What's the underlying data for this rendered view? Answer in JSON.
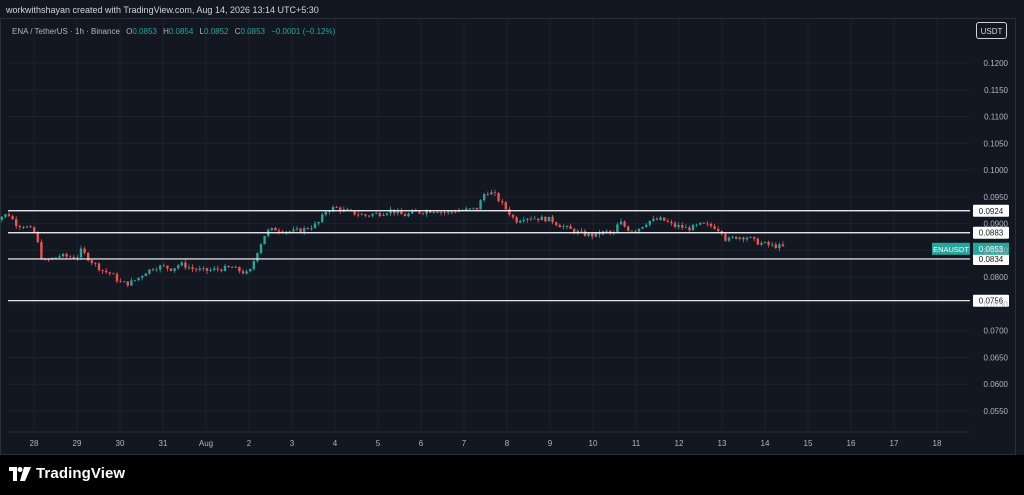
{
  "credit": "workwithshayan created with TradingView.com, Aug 14, 2026 13:14 UTC+5:30",
  "symbol": {
    "name": "ENA / TetherUS · 1h · Binance",
    "o_label": "O",
    "o": "0.0853",
    "h_label": "H",
    "h": "0.0854",
    "l_label": "L",
    "l": "0.0852",
    "c_label": "C",
    "c": "0.0853",
    "change": "−0.0001 (−0.12%)"
  },
  "currency_button": "USDT",
  "brand": "TradingView",
  "colors": {
    "up": "#26a69a",
    "down": "#ef5350",
    "level_line": "#ffffff",
    "background": "#131722",
    "grid": "#1e222d"
  },
  "chart_data": {
    "type": "candlestick",
    "symbol": "ENAUSDT",
    "interval": "1h",
    "y_axis": {
      "ticks": [
        "0.1200",
        "0.1150",
        "0.1100",
        "0.1050",
        "0.1000",
        "0.0950",
        "0.0900",
        "0.0850",
        "0.0800",
        "0.0750",
        "0.0700",
        "0.0650",
        "0.0600",
        "0.0550"
      ],
      "range": [
        0.0518,
        0.1247
      ]
    },
    "x_axis": {
      "ticks": [
        "28",
        "29",
        "30",
        "31",
        "Aug",
        "2",
        "3",
        "4",
        "5",
        "6",
        "7",
        "8",
        "9",
        "10",
        "11",
        "12",
        "13",
        "14",
        "15",
        "16",
        "17",
        "18"
      ]
    },
    "horizontal_levels": [
      0.0924,
      0.0883,
      0.0834,
      0.0756
    ],
    "level_labels": [
      "0.0924",
      "0.0883",
      "0.0834",
      "0.0756"
    ],
    "last_price": {
      "label": "ENAUSDT",
      "value": "0.0853"
    },
    "price_path": [
      [
        "27",
        0.0905
      ],
      [
        "27.2",
        0.0912
      ],
      [
        "27.4",
        0.0918
      ],
      [
        "27.6",
        0.0898
      ],
      [
        "27.8",
        0.0895
      ],
      [
        "28",
        0.0885
      ],
      [
        "28.1",
        0.086
      ],
      [
        "28.2",
        0.0828
      ],
      [
        "28.4",
        0.0834
      ],
      [
        "28.6",
        0.084
      ],
      [
        "28.8",
        0.0838
      ],
      [
        "29",
        0.0838
      ],
      [
        "29.1",
        0.085
      ],
      [
        "29.3",
        0.0832
      ],
      [
        "29.6",
        0.0812
      ],
      [
        "29.8",
        0.0806
      ],
      [
        "30",
        0.079
      ],
      [
        "30.2",
        0.0788
      ],
      [
        "30.4",
        0.0797
      ],
      [
        "30.6",
        0.081
      ],
      [
        "30.8",
        0.0818
      ],
      [
        "31",
        0.082
      ],
      [
        "31.2",
        0.0815
      ],
      [
        "31.4",
        0.0825
      ],
      [
        "31.7",
        0.0815
      ],
      [
        "31.9",
        0.0813
      ],
      [
        "Aug",
        0.0812
      ],
      [
        "1.3",
        0.0815
      ],
      [
        "1.6",
        0.0818
      ],
      [
        "1.9",
        0.0808
      ],
      [
        "2",
        0.0806
      ],
      [
        "2.2",
        0.085
      ],
      [
        "2.4",
        0.0885
      ],
      [
        "2.6",
        0.089
      ],
      [
        "2.8",
        0.0887
      ],
      [
        "3",
        0.0885
      ],
      [
        "3.3",
        0.089
      ],
      [
        "3.6",
        0.09
      ],
      [
        "3.8",
        0.0925
      ],
      [
        "4",
        0.093
      ],
      [
        "4.3",
        0.0922
      ],
      [
        "4.7",
        0.0915
      ],
      [
        "4.9",
        0.0918
      ],
      [
        "5",
        0.0918
      ],
      [
        "5.3",
        0.0925
      ],
      [
        "5.6",
        0.0915
      ],
      [
        "5.8",
        0.092
      ],
      [
        "6",
        0.0922
      ],
      [
        "6.3",
        0.0925
      ],
      [
        "6.6",
        0.092
      ],
      [
        "6.8",
        0.0924
      ],
      [
        "7",
        0.0925
      ],
      [
        "7.3",
        0.0928
      ],
      [
        "7.5",
        0.096
      ],
      [
        "7.7",
        0.0955
      ],
      [
        "7.9",
        0.0935
      ],
      [
        "8",
        0.0925
      ],
      [
        "8.2",
        0.0905
      ],
      [
        "8.4",
        0.0912
      ],
      [
        "8.7",
        0.091
      ],
      [
        "9",
        0.0908
      ],
      [
        "9.2",
        0.0898
      ],
      [
        "9.5",
        0.0888
      ],
      [
        "9.8",
        0.088
      ],
      [
        "10",
        0.0878
      ],
      [
        "10.3",
        0.0885
      ],
      [
        "10.5",
        0.088
      ],
      [
        "10.6",
        0.0905
      ],
      [
        "10.8",
        0.089
      ],
      [
        "11",
        0.0888
      ],
      [
        "11.3",
        0.0905
      ],
      [
        "11.6",
        0.0908
      ],
      [
        "11.9",
        0.0895
      ],
      [
        "12",
        0.0895
      ],
      [
        "12.2",
        0.089
      ],
      [
        "12.5",
        0.0898
      ],
      [
        "12.8",
        0.0895
      ],
      [
        "13",
        0.0885
      ],
      [
        "13.1",
        0.0868
      ],
      [
        "13.3",
        0.0875
      ],
      [
        "13.6",
        0.0875
      ],
      [
        "13.8",
        0.0865
      ],
      [
        "14",
        0.0862
      ],
      [
        "14.2",
        0.0858
      ],
      [
        "14.4",
        0.0857
      ],
      [
        "14.5",
        0.0853
      ]
    ]
  }
}
